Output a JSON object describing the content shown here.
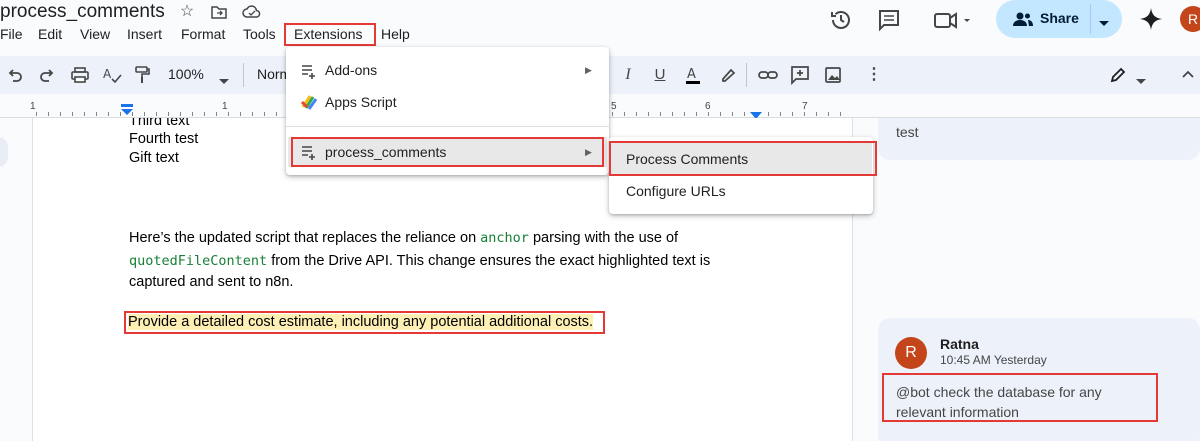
{
  "document": {
    "title": "process_comments"
  },
  "menubar": {
    "items": [
      "File",
      "Edit",
      "View",
      "Insert",
      "Format",
      "Tools",
      "Extensions",
      "Help"
    ]
  },
  "header": {
    "share_label": "Share",
    "account_initial": "R"
  },
  "toolbar": {
    "zoom": "100%",
    "style": "Norm"
  },
  "ruler": {
    "numbers": [
      "1",
      "1",
      "5",
      "6",
      "7"
    ]
  },
  "body": {
    "line1": "Third text",
    "line2": "Fourth test",
    "line3": "Gift text",
    "para_a1": "Here’s the updated script that replaces the reliance on ",
    "para_code1": "anchor",
    "para_a2": " parsing with the use of",
    "para_code2": "quotedFileContent",
    "para_b1": " from the Drive API. This change ensures the exact highlighted text is",
    "para_c": "captured and sent to n8n.",
    "highlighted": "Provide a detailed cost estimate, including any potential additional costs."
  },
  "extensions_menu": {
    "items": [
      {
        "label": "Add-ons",
        "icon": "add-ons-icon",
        "submenu": true
      },
      {
        "label": "Apps Script",
        "icon": "apps-script-icon",
        "submenu": false
      },
      {
        "label": "process_comments",
        "icon": "add-on-list-icon",
        "submenu": true
      }
    ]
  },
  "submenu": {
    "items": [
      "Process Comments",
      "Configure URLs"
    ]
  },
  "comments": {
    "previous_text": "test",
    "author": "Ratna",
    "author_initial": "R",
    "time": "10:45 AM Yesterday",
    "body": "@bot check the database for any relevant information"
  },
  "colors": {
    "accent_red": "#e53935",
    "share_bg": "#c2e7ff",
    "avatar": "#c5451b",
    "code_green": "#188038",
    "highlight": "#fef0b5"
  }
}
